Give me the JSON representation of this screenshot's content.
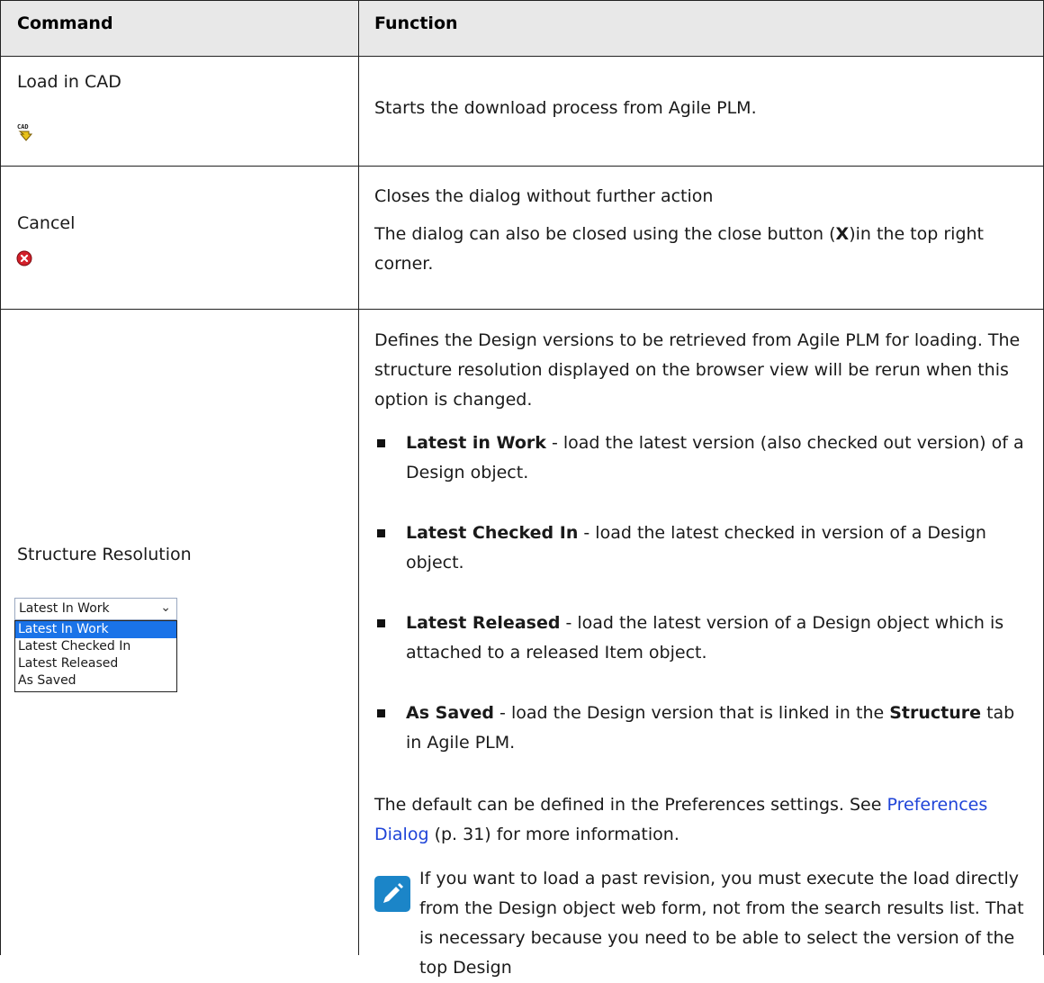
{
  "table": {
    "headers": {
      "command": "Command",
      "function": "Function"
    },
    "rows": [
      {
        "command": "Load in CAD",
        "icon": "cad-load-icon",
        "function": "Starts the download process from Agile PLM."
      },
      {
        "command": "Cancel",
        "icon": "cancel-red-circle-icon",
        "function_lines": [
          "Closes the dialog without further action",
          "The dialog can also be closed using the close button (",
          "X",
          ")in the top right corner."
        ]
      },
      {
        "command": "Structure Resolution",
        "dropdown": {
          "selected": "Latest In Work",
          "options": [
            "Latest In Work",
            "Latest Checked In",
            "Latest Released",
            "As Saved"
          ]
        },
        "intro": "Defines the Design versions to be retrieved from Agile PLM for loading. The structure resolution displayed on the browser view will be rerun when this option is changed.",
        "bullets": [
          {
            "term": "Latest in Work",
            "text": " - load the latest version (also checked out version) of a Design object."
          },
          {
            "term": "Latest Checked In",
            "text": " - load the latest checked in version of a Design object."
          },
          {
            "term": "Latest Released",
            "text": " - load the latest version of a Design object which is attached to a released Item object."
          },
          {
            "term": "As Saved",
            "text_before": " - load the Design version that is linked in the ",
            "bold_mid": "Structure",
            "text_after": " tab in Agile PLM."
          }
        ],
        "default_note": "The default can be defined in the Preferences settings. See ",
        "link_text": "Preferences Dialog",
        "link_suffix": " (p. 31) for more information.",
        "note_icon": "pencil-note-icon",
        "note_text": "If you want to load a past revision, you must execute the load directly from the Design object web form, not from the search results list. That is necessary because you need to be able to select the version of the top Design"
      }
    ]
  }
}
